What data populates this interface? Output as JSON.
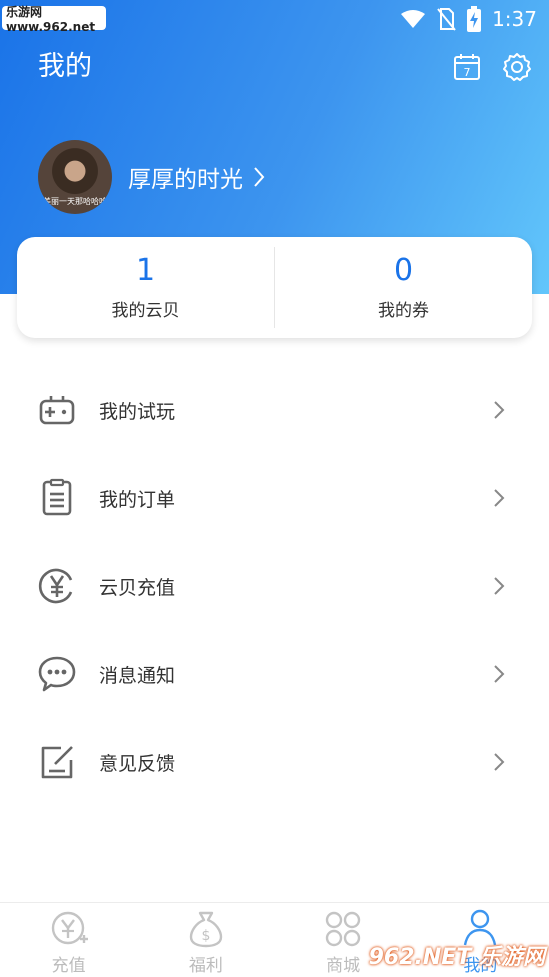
{
  "status_bar": {
    "watermark": "乐游网 www.962.net",
    "time": "1:37"
  },
  "header": {
    "title": "我的",
    "username": "厚厚的时光",
    "avatar_caption": "美丽一天那哈哈哈"
  },
  "stats": [
    {
      "value": "1",
      "label": "我的云贝"
    },
    {
      "value": "0",
      "label": "我的券"
    }
  ],
  "menu": [
    {
      "label": "我的试玩",
      "icon": "gamepad-icon"
    },
    {
      "label": "我的订单",
      "icon": "order-list-icon"
    },
    {
      "label": "云贝充值",
      "icon": "yen-coin-icon"
    },
    {
      "label": "消息通知",
      "icon": "chat-bubble-icon"
    },
    {
      "label": "意见反馈",
      "icon": "feedback-edit-icon"
    }
  ],
  "tabs": [
    {
      "label": "充值",
      "icon": "recharge-icon",
      "active": false
    },
    {
      "label": "福利",
      "icon": "money-bag-icon",
      "active": false
    },
    {
      "label": "商城",
      "icon": "grid-icon",
      "active": false
    },
    {
      "label": "我的",
      "icon": "profile-icon",
      "active": true
    }
  ],
  "bottom_watermark": "962.NET 乐游网",
  "colors": {
    "accent": "#1a73e8",
    "header_end": "#62c6fb"
  }
}
